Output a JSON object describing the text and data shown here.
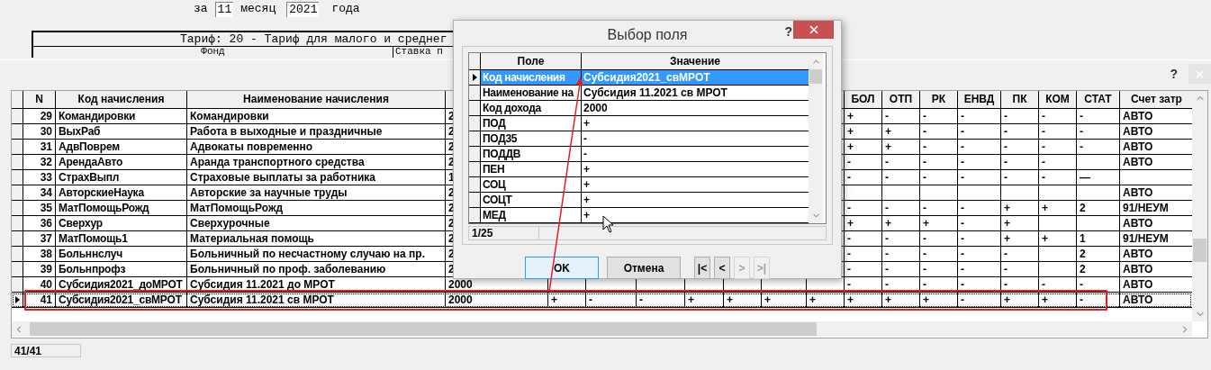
{
  "header": {
    "prefix": "за",
    "month": "11",
    "month_label": "месяц",
    "year": "2021",
    "year_label": "года"
  },
  "tariff": {
    "title": "Тариф: 20 - Тариф для малого и среднег",
    "columns": [
      "Фонд",
      "Ставка п"
    ]
  },
  "window": {
    "help": "?"
  },
  "grid": {
    "columns_left": [
      "N",
      "Код начисления",
      "Наименование начисления"
    ],
    "columns_right": [
      "БОЛ",
      "ОТП",
      "РК",
      "ЕНВД",
      "ПК",
      "КОМ",
      "СТАТ",
      "Счет затр"
    ],
    "rows": [
      {
        "n": "29",
        "code": "Командировки",
        "name": "Командировки",
        "income": "2",
        "right": {
          "bol": "+",
          "otp": "-",
          "rk": "-",
          "envd": "-",
          "pk": "-",
          "kom": "-",
          "stat": "-",
          "account": "АВТО"
        },
        "selected": false
      },
      {
        "n": "30",
        "code": "ВыхРаб",
        "name": "Работа в выходные и праздничные",
        "income": "2",
        "right": {
          "bol": "+",
          "otp": "+",
          "rk": "-",
          "envd": "-",
          "pk": "-",
          "kom": "-",
          "stat": "-",
          "account": "АВТО"
        },
        "selected": false
      },
      {
        "n": "31",
        "code": "АдвПоврем",
        "name": "Адвокаты повременно",
        "income": "2",
        "right": {
          "bol": "+",
          "otp": "+",
          "rk": "-",
          "envd": "-",
          "pk": "-",
          "kom": "-",
          "stat": "-",
          "account": "АВТО"
        },
        "selected": false
      },
      {
        "n": "32",
        "code": "АрендаАвто",
        "name": "Аранда транспортного средства",
        "income": "2",
        "right": {
          "bol": "-",
          "otp": "-",
          "rk": "-",
          "envd": "-",
          "pk": "-",
          "kom": "-",
          "account": "АВТО"
        },
        "selected": false
      },
      {
        "n": "33",
        "code": "СтрахВыпл",
        "name": "Страховые выплаты за работника",
        "income": "1",
        "right": {
          "bol": "-",
          "otp": "-",
          "rk": "-",
          "envd": "-",
          "pk": "-",
          "kom": "-",
          "stat": "—"
        },
        "selected": false
      },
      {
        "n": "34",
        "code": "АвторскиеНаука",
        "name": "Авторские за научные труды",
        "income": "2",
        "right": {
          "account": "АВТО"
        },
        "selected": false
      },
      {
        "n": "35",
        "code": "МатПомощьРожд",
        "name": "МатПомощьРожд",
        "income": "2",
        "right": {
          "bol": "-",
          "otp": "-",
          "rk": "-",
          "envd": "-",
          "pk": "+",
          "kom": "+",
          "stat": "2",
          "account": "91/НЕУМ"
        },
        "selected": false
      },
      {
        "n": "36",
        "code": "Сверхур",
        "name": "Сверхурочные",
        "income": "2",
        "right": {
          "bol": "+",
          "otp": "+",
          "rk": "+",
          "envd": "-",
          "pk": "+",
          "account": "АВТО"
        },
        "selected": false
      },
      {
        "n": "37",
        "code": "МатПомощь1",
        "name": "Материальная помощь",
        "income": "2",
        "right": {
          "bol": "-",
          "otp": "-",
          "rk": "-",
          "envd": "-",
          "pk": "+",
          "kom": "+",
          "stat": "1",
          "account": "91/НЕУМ"
        },
        "selected": false
      },
      {
        "n": "38",
        "code": "Больннслуч",
        "name": "Больничный по несчастному случаю на пр.",
        "income": "2",
        "right": {
          "bol": "-",
          "otp": "-",
          "rk": "-",
          "envd": "-",
          "pk": "-",
          "stat": "2",
          "account": "АВТО"
        },
        "selected": false
      },
      {
        "n": "39",
        "code": "Больнпрофз",
        "name": "Больничный по проф. заболеванию",
        "income": "2",
        "right": {
          "bol": "-",
          "otp": "-",
          "rk": "-",
          "envd": "-",
          "pk": "-",
          "stat": "2",
          "account": "АВТО"
        },
        "selected": false
      },
      {
        "n": "40",
        "code": "Субсидия2021_доМРОТ",
        "name": "Субсидия 11.2021 до МРОТ",
        "income": "2000",
        "right": {
          "bol": "-",
          "otp": "-",
          "rk": "-",
          "envd": "-",
          "pk": "-",
          "kom": "-",
          "stat": "-",
          "account": "АВТО"
        },
        "selected": false
      },
      {
        "n": "41",
        "code": "Субсидия2021_свМРОТ",
        "name": "Субсидия 11.2021 св МРОТ",
        "income": "2000",
        "flags": [
          "+",
          "-",
          "-",
          "+",
          "+",
          "+",
          "+"
        ],
        "right": {
          "bol": "+",
          "otp": "+",
          "rk": "+",
          "envd": "-",
          "pk": "+",
          "kom": "+",
          "stat": "-",
          "account": "АВТО"
        },
        "selected": true
      }
    ],
    "status": "41/41"
  },
  "dialog": {
    "title": "Выбор поля",
    "help": "?",
    "columns": [
      "Поле",
      "Значение"
    ],
    "rows": [
      {
        "field": "Код начисления",
        "value": "Субсидия2021_свМРОТ",
        "selected": true
      },
      {
        "field": "Наименование на",
        "value": "Субсидия 11.2021 св МРОТ",
        "selected": false
      },
      {
        "field": "Код дохода",
        "value": "2000",
        "selected": false
      },
      {
        "field": "ПОД",
        "value": "+",
        "selected": false
      },
      {
        "field": "ПОД35",
        "value": "-",
        "selected": false
      },
      {
        "field": "ПОДДВ",
        "value": "-",
        "selected": false
      },
      {
        "field": "ПЕН",
        "value": "+",
        "selected": false
      },
      {
        "field": "СОЦ",
        "value": "+",
        "selected": false
      },
      {
        "field": "СОЦТ",
        "value": "+",
        "selected": false
      },
      {
        "field": "МЕД",
        "value": "+",
        "selected": false
      }
    ],
    "status": "1/25",
    "buttons": [
      {
        "label": "OK",
        "default": true
      },
      {
        "label": "Отмена",
        "default": false
      }
    ],
    "nav": [
      {
        "label": "|<",
        "disabled": false
      },
      {
        "label": "<",
        "disabled": false
      },
      {
        "label": ">",
        "disabled": true
      },
      {
        "label": ">|",
        "disabled": true
      }
    ]
  }
}
